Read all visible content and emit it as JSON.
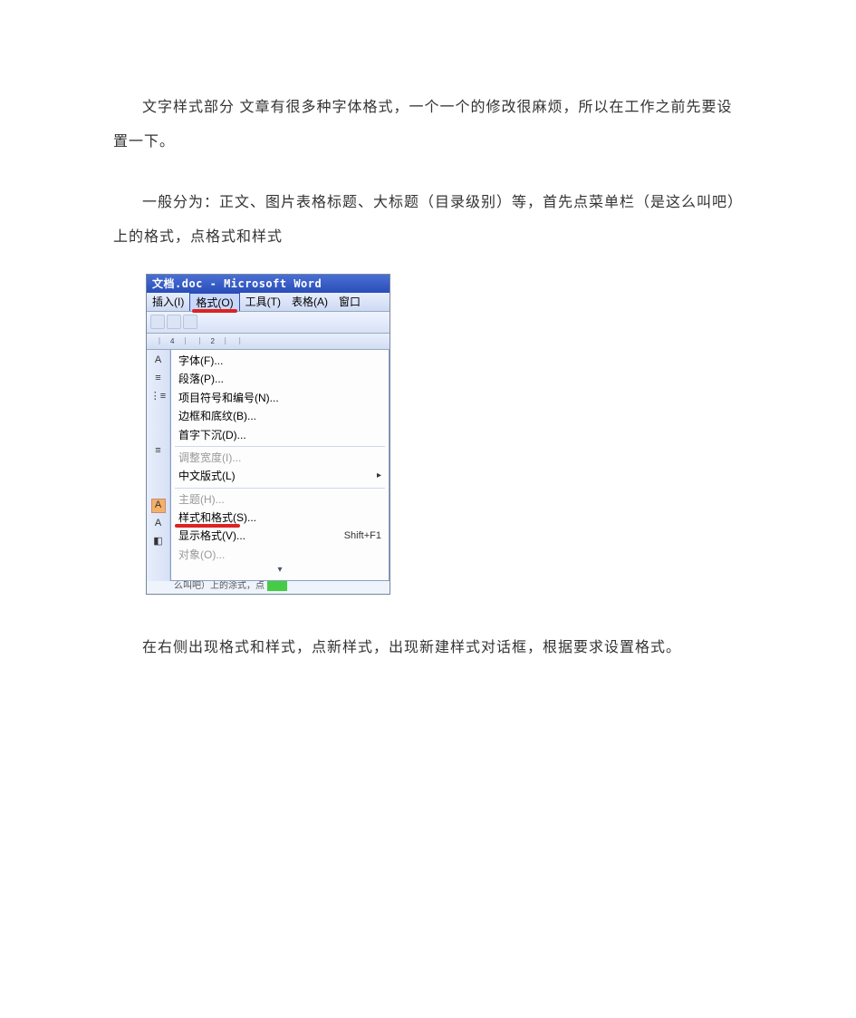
{
  "paragraphs": {
    "p1": "文字样式部分  文章有很多种字体格式，一个一个的修改很麻烦，所以在工作之前先要设置一下。",
    "p2": "一般分为：正文、图片表格标题、大标题（目录级别）等，首先点菜单栏（是这么叫吧）上的格式，点格式和样式",
    "p3": "在右侧出现格式和样式，点新样式，出现新建样式对话框，根据要求设置格式。"
  },
  "word_window": {
    "title": "文档.doc - Microsoft Word",
    "menu": {
      "insert": "插入(I)",
      "format": "格式(O)",
      "tools": "工具(T)",
      "table": "表格(A)",
      "window": "窗口"
    },
    "ruler_marks": "｜4｜｜2｜｜",
    "dropdown": {
      "font": "字体(F)...",
      "paragraph": "段落(P)...",
      "bullets": "项目符号和编号(N)...",
      "borders": "边框和底纹(B)...",
      "dropcap": "首字下沉(D)...",
      "adjust_width": "调整宽度(I)...",
      "cjk_layout": "中文版式(L)",
      "theme": "主题(H)...",
      "styles": "样式和格式(S)...",
      "reveal": "显示格式(V)...",
      "reveal_shortcut": "Shift+F1",
      "object": "对象(O)..."
    },
    "footer_scrap": "么叫吧）上的涂式，点"
  }
}
